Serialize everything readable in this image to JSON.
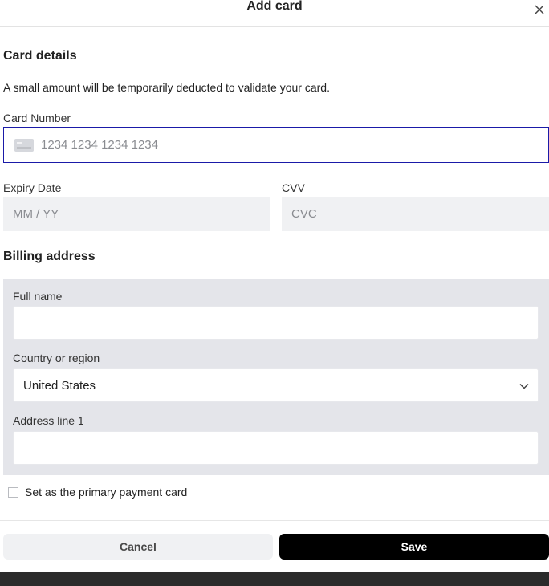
{
  "dialog": {
    "title": "Add card"
  },
  "card_details": {
    "heading": "Card details",
    "description": "A small amount will be temporarily deducted to validate your card.",
    "card_number": {
      "label": "Card Number",
      "value": "",
      "placeholder": "1234 1234 1234 1234"
    },
    "expiry": {
      "label": "Expiry Date",
      "value": "",
      "placeholder": "MM / YY"
    },
    "cvv": {
      "label": "CVV",
      "value": "",
      "placeholder": "CVC"
    }
  },
  "billing": {
    "heading": "Billing address",
    "full_name": {
      "label": "Full name",
      "value": ""
    },
    "country": {
      "label": "Country or region",
      "value": "United States"
    },
    "address1": {
      "label": "Address line 1",
      "value": ""
    }
  },
  "primary_checkbox": {
    "label": "Set as the primary payment card",
    "checked": false
  },
  "actions": {
    "cancel_label": "Cancel",
    "save_label": "Save"
  },
  "icons": [
    "close-icon",
    "credit-card-icon",
    "chevron-down-icon"
  ],
  "colors": {
    "focus_border": "#1a1aa8",
    "save_bg": "#000000",
    "billing_bg": "#e4e5ea"
  }
}
